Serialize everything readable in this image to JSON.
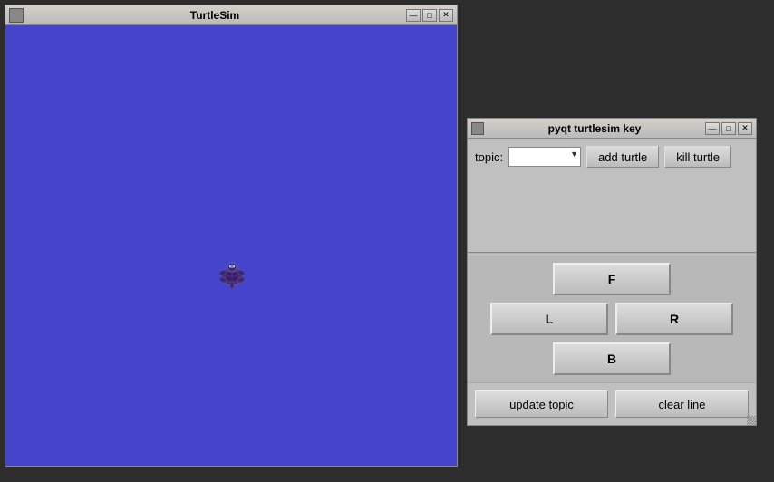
{
  "turtlesim": {
    "title": "TurtleSim",
    "btn_minimize": "—",
    "btn_restore": "□",
    "btn_close": "✕",
    "canvas_color": "#4545cc"
  },
  "pyqt": {
    "title": "pyqt turtlesim key",
    "btn_minimize": "—",
    "btn_restore": "□",
    "btn_close": "✕",
    "topic_label": "topic:",
    "add_turtle_label": "add turtle",
    "kill_turtle_label": "kill turtle",
    "forward_label": "F",
    "left_label": "L",
    "right_label": "R",
    "backward_label": "B",
    "update_topic_label": "update topic",
    "clear_line_label": "clear line"
  }
}
